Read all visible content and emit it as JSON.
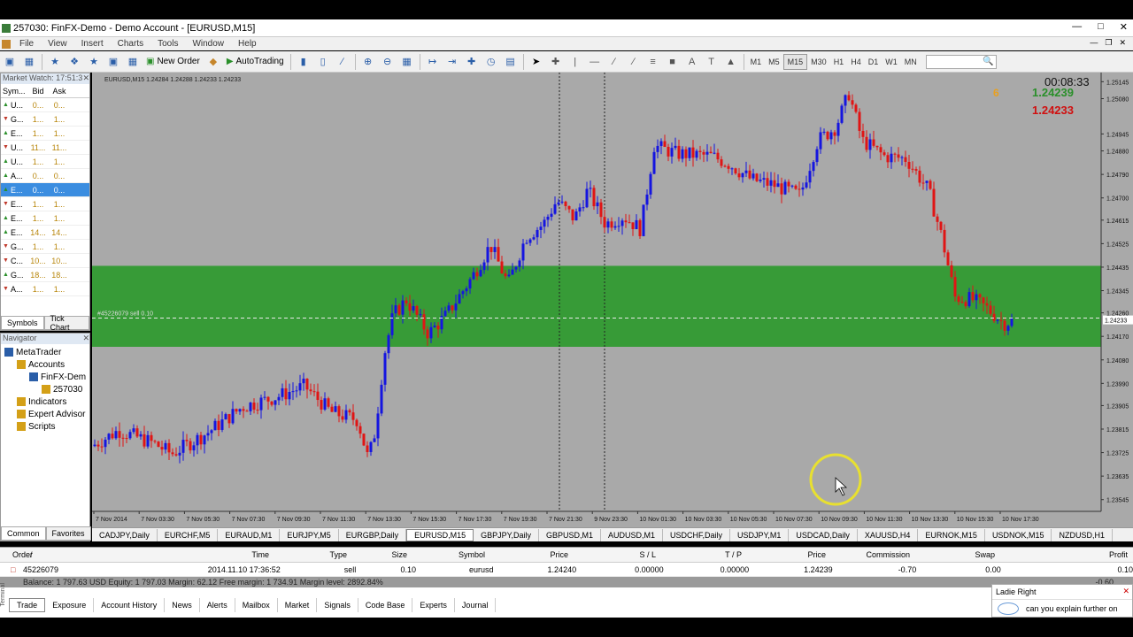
{
  "window": {
    "title": "257030: FinFX-Demo - Demo Account - [EURUSD,M15]"
  },
  "menu": [
    "File",
    "View",
    "Insert",
    "Charts",
    "Tools",
    "Window",
    "Help"
  ],
  "toolbar": {
    "new_order": "New Order",
    "autotrading": "AutoTrading",
    "timeframes": [
      "M1",
      "M5",
      "M15",
      "M30",
      "H1",
      "H4",
      "D1",
      "W1",
      "MN"
    ],
    "active_tf": "M15"
  },
  "market_watch": {
    "title": "Market Watch: 17:51:3",
    "cols": [
      "Sym...",
      "Bid",
      "Ask"
    ],
    "rows": [
      {
        "s": "U...",
        "b": "0...",
        "a": "0...",
        "dir": "up"
      },
      {
        "s": "G...",
        "b": "1...",
        "a": "1...",
        "dir": "dn"
      },
      {
        "s": "E...",
        "b": "1...",
        "a": "1...",
        "dir": "up"
      },
      {
        "s": "U...",
        "b": "11...",
        "a": "11...",
        "dir": "dn"
      },
      {
        "s": "U...",
        "b": "1...",
        "a": "1...",
        "dir": "up"
      },
      {
        "s": "A...",
        "b": "0...",
        "a": "0...",
        "dir": "up"
      },
      {
        "s": "E...",
        "b": "0...",
        "a": "0...",
        "dir": "up",
        "sel": true
      },
      {
        "s": "E...",
        "b": "1...",
        "a": "1...",
        "dir": "dn"
      },
      {
        "s": "E...",
        "b": "1...",
        "a": "1...",
        "dir": "up"
      },
      {
        "s": "E...",
        "b": "14...",
        "a": "14...",
        "dir": "up"
      },
      {
        "s": "G...",
        "b": "1...",
        "a": "1...",
        "dir": "dn"
      },
      {
        "s": "C...",
        "b": "10...",
        "a": "10...",
        "dir": "dn"
      },
      {
        "s": "G...",
        "b": "18...",
        "a": "18...",
        "dir": "up"
      },
      {
        "s": "A...",
        "b": "1...",
        "a": "1...",
        "dir": "dn"
      }
    ],
    "tabs": [
      "Symbols",
      "Tick Chart"
    ]
  },
  "navigator": {
    "title": "Navigator",
    "items": [
      {
        "label": "MetaTrader",
        "indent": 0
      },
      {
        "label": "Accounts",
        "indent": 1
      },
      {
        "label": "FinFX-Dem",
        "indent": 2
      },
      {
        "label": "257030",
        "indent": 3
      },
      {
        "label": "Indicators",
        "indent": 1
      },
      {
        "label": "Expert Advisor",
        "indent": 1
      },
      {
        "label": "Scripts",
        "indent": 1
      }
    ],
    "tabs": [
      "Common",
      "Favorites"
    ]
  },
  "chart": {
    "header": "EURUSD,M15  1.24284 1.24288 1.24233 1.24233",
    "timer": "00:08:33",
    "bid": "1.24239",
    "ask": "1.24233",
    "badge": "6",
    "order_line_label": "#45226079 sell 0.10",
    "current_price_label": "1.24233",
    "price_ticks": [
      "1.25145",
      "1.25080",
      "1.24945",
      "1.24880",
      "1.24790",
      "1.24700",
      "1.24615",
      "1.24525",
      "1.24435",
      "1.24345",
      "1.24260",
      "1.24170",
      "1.24080",
      "1.23990",
      "1.23905",
      "1.23815",
      "1.23725",
      "1.23635",
      "1.23545"
    ],
    "time_ticks": [
      "7 Nov 2014",
      "7 Nov 03:30",
      "7 Nov 05:30",
      "7 Nov 07:30",
      "7 Nov 09:30",
      "7 Nov 11:30",
      "7 Nov 13:30",
      "7 Nov 15:30",
      "7 Nov 17:30",
      "7 Nov 19:30",
      "7 Nov 21:30",
      "9 Nov 23:30",
      "10 Nov 01:30",
      "10 Nov 03:30",
      "10 Nov 05:30",
      "10 Nov 07:30",
      "10 Nov 09:30",
      "10 Nov 11:30",
      "10 Nov 13:30",
      "10 Nov 15:30",
      "10 Nov 17:30"
    ],
    "colors": {
      "bg": "#a9a9a9",
      "zone": "#2e9a2e",
      "bull": "#1515e0",
      "bear": "#e01515",
      "bid": "#2a8f2a",
      "ask": "#d01010"
    }
  },
  "chart_tabs": [
    "CADJPY,Daily",
    "EURCHF,M5",
    "EURAUD,M1",
    "EURJPY,M5",
    "EURGBP,Daily",
    "EURUSD,M15",
    "GBPJPY,Daily",
    "GBPUSD,M1",
    "AUDUSD,M1",
    "USDCHF,Daily",
    "USDJPY,M1",
    "USDCAD,Daily",
    "XAUUSD,H4",
    "EURNOK,M15",
    "USDNOK,M15",
    "NZDUSD,H1"
  ],
  "chart_tab_active": "EURUSD,M15",
  "terminal": {
    "cols": [
      "Order",
      "/",
      "Time",
      "Type",
      "Size",
      "Symbol",
      "Price",
      "S / L",
      "T / P",
      "Price",
      "Commission",
      "Swap",
      "Profit"
    ],
    "row": {
      "order": "45226079",
      "time": "2014.11.10 17:36:52",
      "type": "sell",
      "size": "0.10",
      "symbol": "eurusd",
      "price": "1.24240",
      "sl": "0.00000",
      "tp": "0.00000",
      "cur": "1.24239",
      "commission": "-0.70",
      "swap": "0.00",
      "profit": "0.10"
    },
    "balance": "Balance: 1 797.63 USD  Equity: 1 797.03  Margin: 62.12  Free margin: 1 734.91  Margin level: 2892.84%",
    "balance_profit": "-0.60",
    "tabs": [
      "Trade",
      "Exposure",
      "Account History",
      "News",
      "Alerts",
      "Mailbox",
      "Market",
      "Signals",
      "Code Base",
      "Experts",
      "Journal"
    ],
    "side_label": "Terminal"
  },
  "chat": {
    "title": "Ladie  Right",
    "message": "can you explain further on"
  }
}
